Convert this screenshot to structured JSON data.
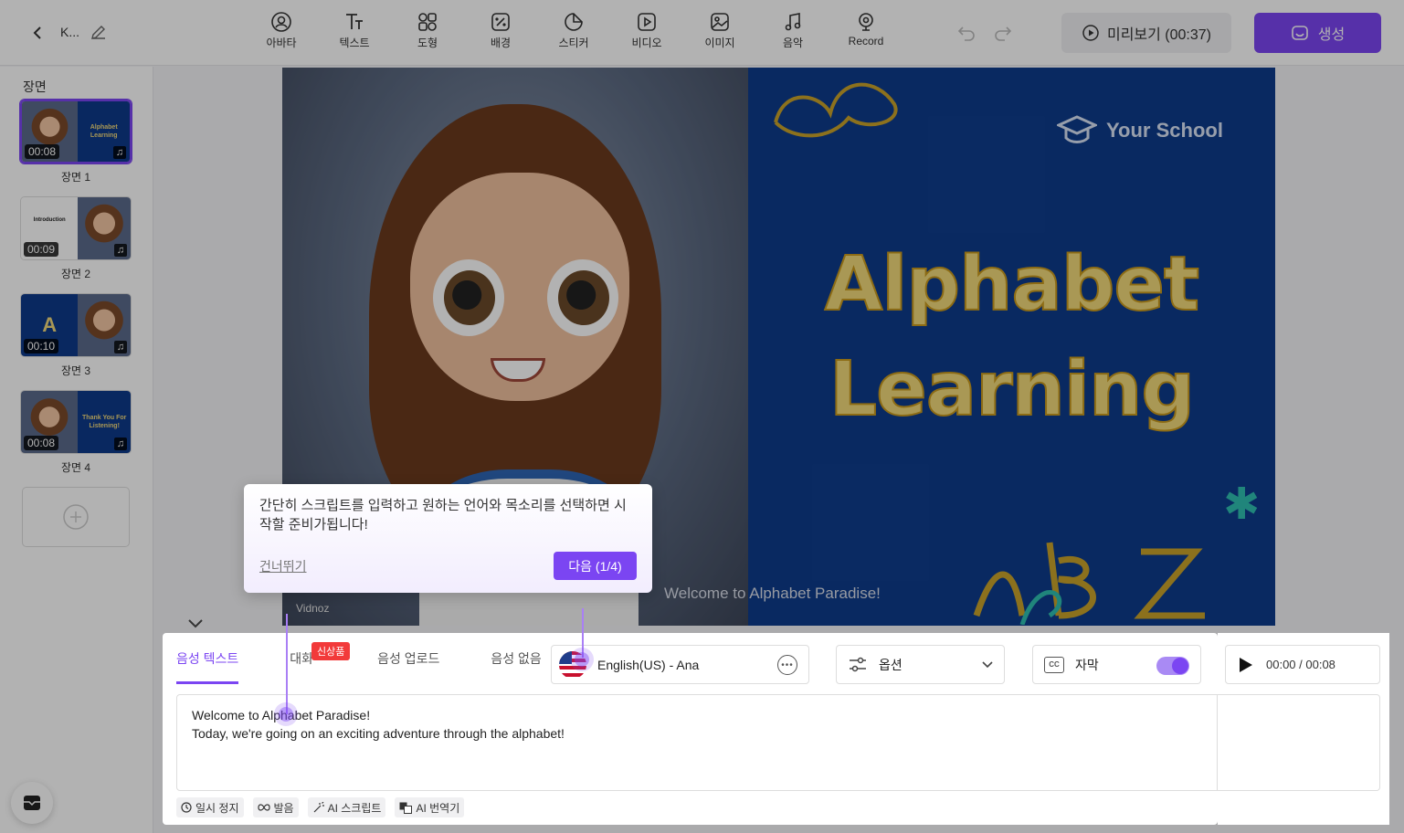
{
  "topbar": {
    "project_name": "K...",
    "tools": [
      {
        "label": "아바타",
        "icon": "avatar-icon"
      },
      {
        "label": "텍스트",
        "icon": "text-icon"
      },
      {
        "label": "도형",
        "icon": "shapes-icon"
      },
      {
        "label": "배경",
        "icon": "background-icon"
      },
      {
        "label": "스티커",
        "icon": "sticker-icon"
      },
      {
        "label": "비디오",
        "icon": "video-icon"
      },
      {
        "label": "이미지",
        "icon": "image-icon"
      },
      {
        "label": "음악",
        "icon": "music-icon"
      },
      {
        "label": "Record",
        "icon": "record-icon"
      }
    ],
    "preview_label": "미리보기 (00:37)",
    "create_label": "생성"
  },
  "scenes": {
    "title": "장면",
    "items": [
      {
        "label": "장면 1",
        "duration": "00:08",
        "thumb_text": "Alphabet Learning",
        "active": true
      },
      {
        "label": "장면 2",
        "duration": "00:09",
        "thumb_text": "Introduction",
        "active": false
      },
      {
        "label": "장면 3",
        "duration": "00:10",
        "thumb_text": "A",
        "active": false
      },
      {
        "label": "장면 4",
        "duration": "00:08",
        "thumb_text": "Thank You For Listening!",
        "active": false
      }
    ]
  },
  "canvas": {
    "school": "Your School",
    "title_line1": "Alphabet",
    "title_line2": "Learning",
    "subtitle": "Welcome to Alphabet Paradise!",
    "watermark": "Vidnoz"
  },
  "editor": {
    "tabs": [
      "음성 텍스트",
      "대화",
      "음성 업로드",
      "음성 없음"
    ],
    "new_badge": "신상품",
    "voice": "English(US) - Ana",
    "options_label": "옵션",
    "caption_label": "자막",
    "caption_on": true,
    "script_line1": "Welcome to Alphabet Paradise!",
    "script_line2": "Today, we're going on an exciting adventure through the alphabet!",
    "chips": [
      "일시 정지",
      "발음",
      "AI 스크립트",
      "AI 번역기"
    ],
    "player_time": "00:00 / 00:08"
  },
  "tooltip": {
    "text": "간단히 스크립트를 입력하고 원하는 언어와 목소리를 선택하면 시작할 준비가됩니다!",
    "skip": "건너뛰기",
    "next": "다음 (1/4)"
  },
  "colors": {
    "accent": "#7b45f2",
    "canvas_bg": "#0e3c8c",
    "title": "#f2da7a"
  }
}
